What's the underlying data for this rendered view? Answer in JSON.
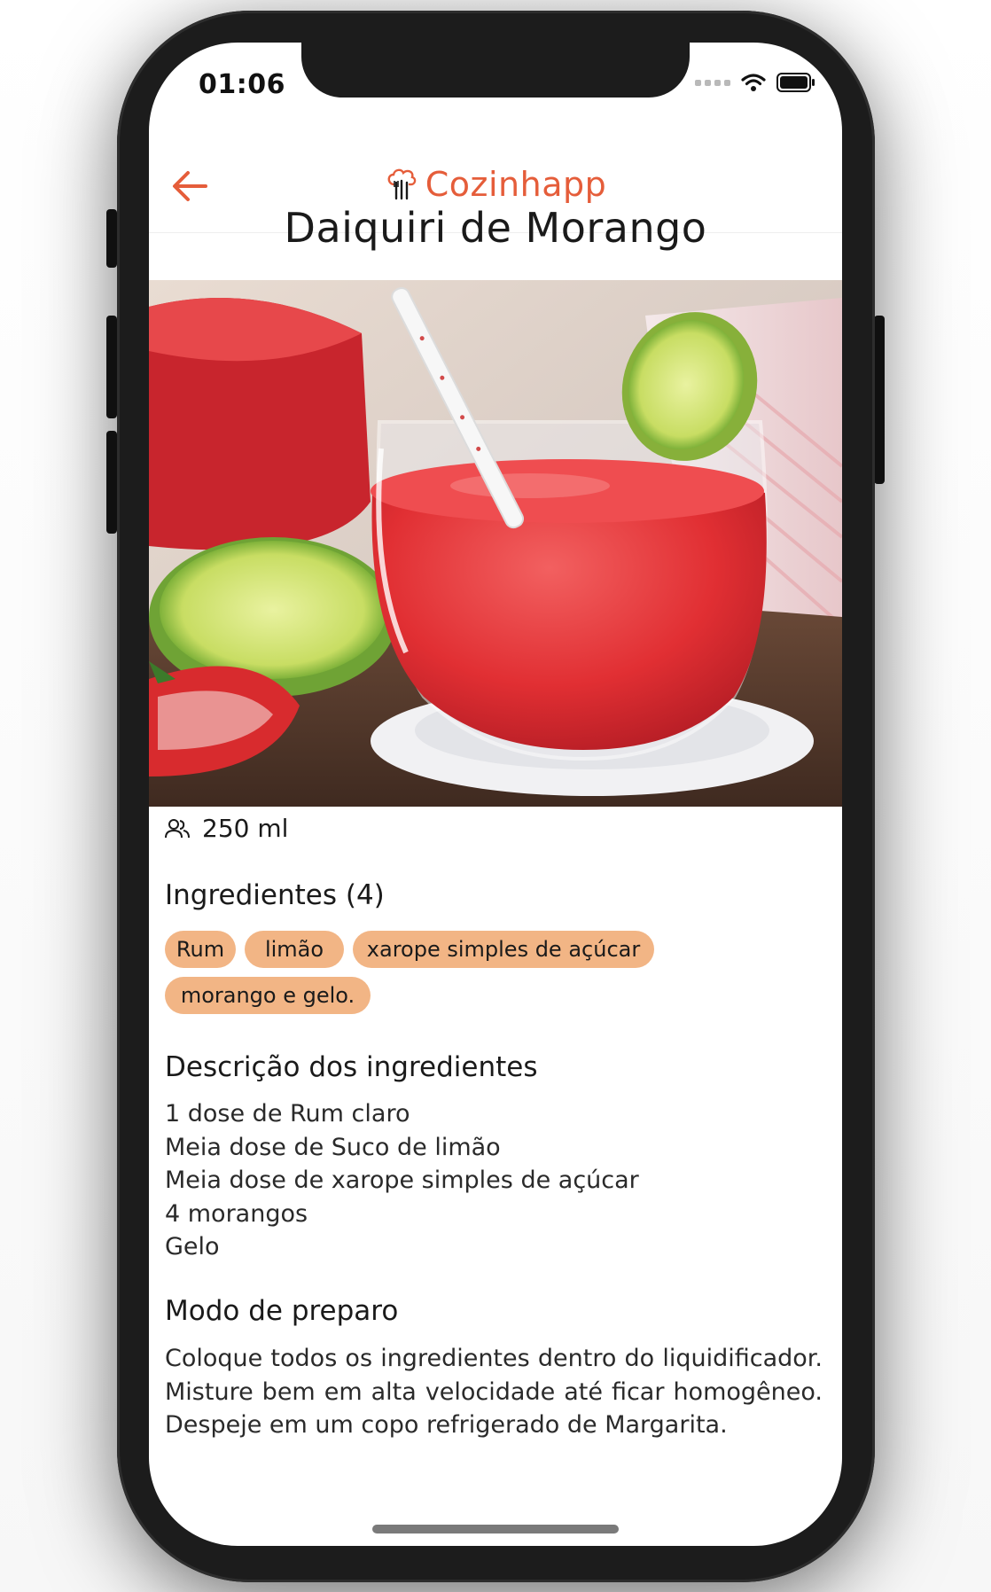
{
  "status_bar": {
    "time": "01:06"
  },
  "header": {
    "app_name": "Cozinhapp",
    "back_icon": "arrow-left-icon",
    "logo_icon": "chef-hat-utensils-icon",
    "accent_color": "#e55d3a"
  },
  "recipe": {
    "title": "Daiquiri de Morango",
    "photo": "strawberry-daiquiri-photo",
    "serving_icon": "people-icon",
    "serving": "250 ml"
  },
  "ingredients": {
    "title": "Ingredientes (4)",
    "tag_color": "#f2b585",
    "tags": [
      "Rum",
      "limão",
      "xarope simples de açúcar",
      "morango e gelo."
    ]
  },
  "description": {
    "title": "Descrição dos ingredientes",
    "lines": [
      "1 dose de Rum claro",
      "Meia dose de Suco de limão",
      "Meia dose de xarope simples de açúcar",
      "4 morangos",
      "Gelo"
    ]
  },
  "preparation": {
    "title": "Modo de preparo",
    "text": "Coloque todos os ingredientes dentro do liquidificador. Misture bem em alta velocidade até ficar homogêneo. Despeje em um copo refrigerado de Margarita."
  }
}
